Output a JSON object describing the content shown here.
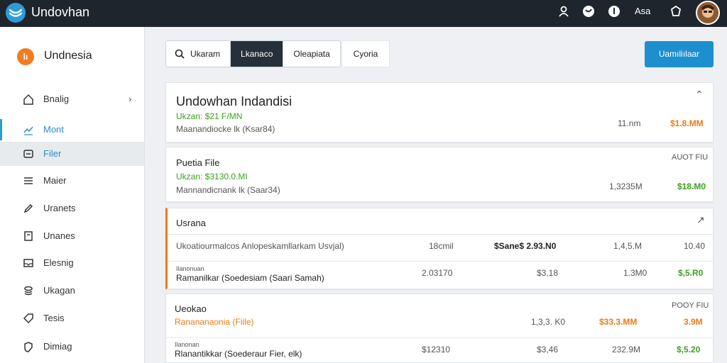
{
  "app": {
    "title": "Undovhan",
    "user_label": "Asa"
  },
  "sidebar": {
    "brand": {
      "mark": "lı",
      "name": "Undnesia"
    },
    "items": [
      {
        "label": "Bnalig",
        "icon": "home-icon"
      },
      {
        "label": "Mont",
        "icon": "trend-icon"
      },
      {
        "label": "Filer",
        "icon": "files-icon"
      },
      {
        "label": "Maier",
        "icon": "list-icon"
      },
      {
        "label": "Uranets",
        "icon": "pencil-icon"
      },
      {
        "label": "Unanes",
        "icon": "doc-icon"
      },
      {
        "label": "Elesnig",
        "icon": "inbox-icon"
      },
      {
        "label": "Ukagan",
        "icon": "coins-icon"
      },
      {
        "label": "Tesis",
        "icon": "tag-icon"
      },
      {
        "label": "Dimiag",
        "icon": "shield-icon"
      }
    ]
  },
  "toolbar": {
    "tabs": [
      "Ukaram",
      "Lkanaco",
      "Oleapiata"
    ],
    "extra_tab": "Cyoria",
    "primary_button": "Uamıliılaar"
  },
  "card1": {
    "title": "Undowhan Indandisi",
    "subtitle": "Ukzan: $21 F/MN",
    "meta": "Maanandiocke lk (Ksar84)",
    "value": "11.nm",
    "total": "$1.8.MM"
  },
  "card2": {
    "title": "Puetia File",
    "header_right": "AUOT FIU",
    "subtitle": "Ukzan: $3130.0.MI",
    "meta": "Mannandicnank lk (Saar34)",
    "value": "1,3235M",
    "total": "$18.M0"
  },
  "card3": {
    "title": "Usrana",
    "rows": [
      {
        "label": "Ukoatiourmalcos Anlopeskamllarkam Usvjal)",
        "c1": "18cmil",
        "c2": "$Sane$ 2.93.N0",
        "c3": "1,4,5.M",
        "c4": "10.40"
      },
      {
        "label_small": "Ilanonuan",
        "label": "Ramanilkar (Soedesiam (Saari Samah)",
        "c1": "2.03170",
        "c2": "$3,18",
        "c3": "1.3M0",
        "c4": "$,5.R0"
      }
    ]
  },
  "card4": {
    "title": "Ueokao",
    "header_right": "POOY FIU",
    "rows": [
      {
        "label": "Ranananaonia (Fiile)",
        "c2": "1,3,3. K0",
        "c3": "$33.3.MM",
        "c4": "3.9M"
      },
      {
        "label_small": "Ilanonan",
        "label": "Rlanantikkar (Soederaur Fier, elk)",
        "c1": "$12310",
        "c2": "$3,46",
        "c3": "232.9M",
        "c4": "$,5.20"
      }
    ]
  }
}
